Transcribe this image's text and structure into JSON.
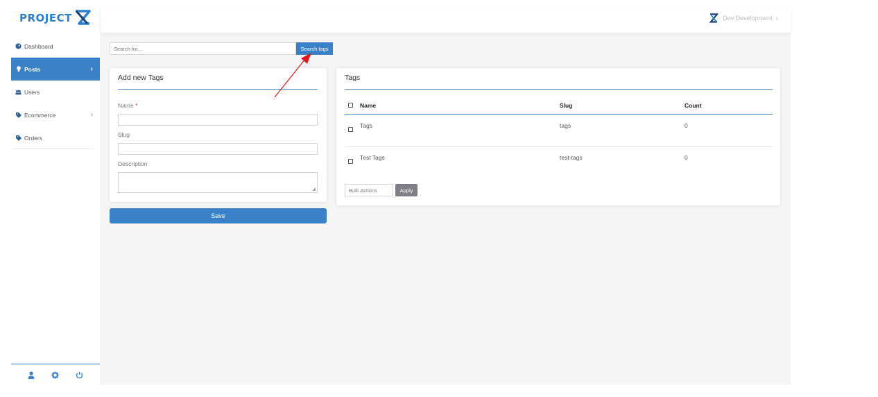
{
  "brand": {
    "name": "PROJECT"
  },
  "sidebar": {
    "items": [
      {
        "label": "Dashboard"
      },
      {
        "label": "Posts"
      },
      {
        "label": "Users"
      },
      {
        "label": "Ecommerce"
      },
      {
        "label": "Orders"
      }
    ]
  },
  "topbar": {
    "user_name": "Dev Development"
  },
  "search": {
    "placeholder": "Search for...",
    "button": "Search tags"
  },
  "add_form": {
    "title": "Add new Tags",
    "name_label": "Name",
    "required_mark": "*",
    "slug_label": "Slug",
    "description_label": "Description",
    "save_label": "Save"
  },
  "tags_table": {
    "title": "Tags",
    "columns": [
      "Name",
      "Slug",
      "Count"
    ],
    "rows": [
      {
        "name": "Tags",
        "slug": "tags",
        "count": "0"
      },
      {
        "name": "Test Tags",
        "slug": "test-tags",
        "count": "0"
      }
    ],
    "bulk_actions_placeholder": "Bulk Actions",
    "apply_label": "Apply"
  },
  "colors": {
    "primary": "#3a81c7",
    "arrow": "#e8141c",
    "apply": "#7e7e86"
  }
}
